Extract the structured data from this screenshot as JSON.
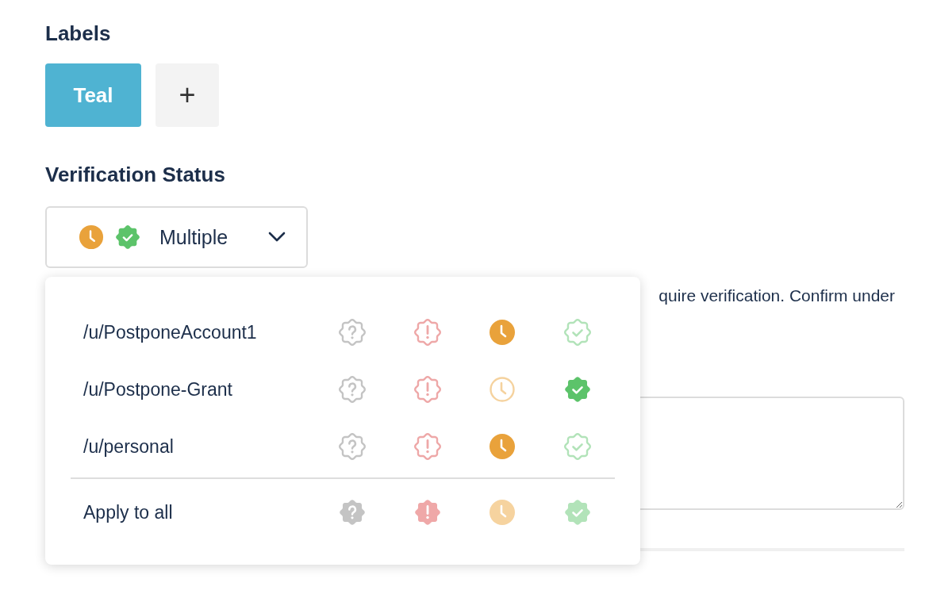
{
  "labels": {
    "heading": "Labels",
    "tags": [
      {
        "label": "Teal",
        "color": "#4fb3d2"
      }
    ],
    "add_button": "+"
  },
  "verification": {
    "heading": "Verification Status",
    "dropdown": {
      "value": "Multiple",
      "statuses": [
        {
          "kind": "pending"
        },
        {
          "kind": "verified"
        }
      ]
    },
    "description": "quire verification. Confirm under",
    "menu": {
      "rows": [
        {
          "account": "/u/PostponeAccount1",
          "statuses": [
            {
              "kind": "unknown",
              "selected": false
            },
            {
              "kind": "flagged",
              "selected": false
            },
            {
              "kind": "pending",
              "selected": true
            },
            {
              "kind": "verified",
              "selected": false
            }
          ]
        },
        {
          "account": "/u/Postpone-Grant",
          "statuses": [
            {
              "kind": "unknown",
              "selected": false
            },
            {
              "kind": "flagged",
              "selected": false
            },
            {
              "kind": "pending",
              "selected": false
            },
            {
              "kind": "verified",
              "selected": true
            }
          ]
        },
        {
          "account": "/u/personal",
          "statuses": [
            {
              "kind": "unknown",
              "selected": false
            },
            {
              "kind": "flagged",
              "selected": false
            },
            {
              "kind": "pending",
              "selected": true
            },
            {
              "kind": "verified",
              "selected": false
            }
          ]
        }
      ],
      "apply_all": {
        "label": "Apply to all",
        "statuses": [
          {
            "kind": "unknown"
          },
          {
            "kind": "flagged"
          },
          {
            "kind": "pending"
          },
          {
            "kind": "verified"
          }
        ]
      }
    }
  }
}
